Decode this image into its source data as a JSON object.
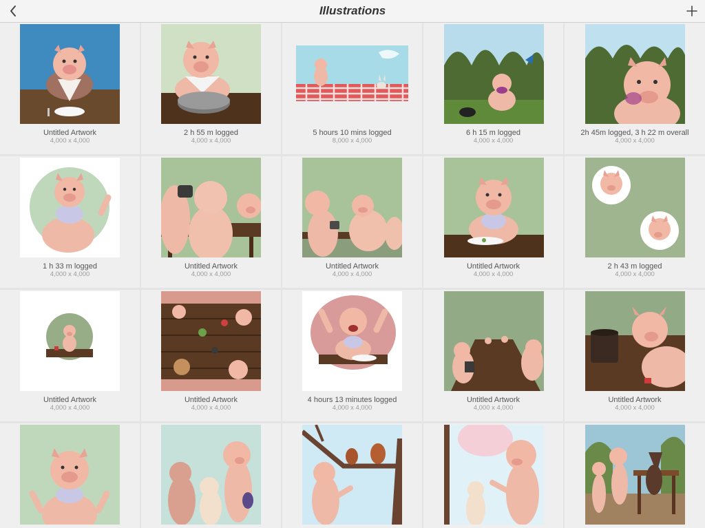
{
  "nav": {
    "title": "Illustrations",
    "back_icon": "chevron-left-icon",
    "add_icon": "plus-icon"
  },
  "artworks": [
    {
      "title": "Untitled Artwork",
      "size": "4,000 x 4,000"
    },
    {
      "title": "2 h 55 m logged",
      "size": "4,000 x 4,000"
    },
    {
      "title": "5 hours 10 mins logged",
      "size": "8,000 x 4,000"
    },
    {
      "title": "6 h 15 m logged",
      "size": "4,000 x 4,000"
    },
    {
      "title": "2h 45m logged, 3 h 22 m overall",
      "size": "4,000 x 4,000"
    },
    {
      "title": "1 h 33 m logged",
      "size": "4,000 x 4,000"
    },
    {
      "title": "Untitled Artwork",
      "size": "4,000 x 4,000"
    },
    {
      "title": "Untitled Artwork",
      "size": "4,000 x 4,000"
    },
    {
      "title": "Untitled Artwork",
      "size": "4,000 x 4,000"
    },
    {
      "title": "2 h 43 m logged",
      "size": "4,000 x 4,000"
    },
    {
      "title": "Untitled Artwork",
      "size": "4,000 x 4,000"
    },
    {
      "title": "Untitled Artwork",
      "size": "4,000 x 4,000"
    },
    {
      "title": "4 hours 13 minutes logged",
      "size": "4,000 x 4,000"
    },
    {
      "title": "Untitled Artwork",
      "size": "4,000 x 4,000"
    },
    {
      "title": "Untitled Artwork",
      "size": "4,000 x 4,000"
    },
    {
      "title": "",
      "size": ""
    },
    {
      "title": "",
      "size": ""
    },
    {
      "title": "",
      "size": ""
    },
    {
      "title": "",
      "size": ""
    },
    {
      "title": "",
      "size": ""
    }
  ]
}
